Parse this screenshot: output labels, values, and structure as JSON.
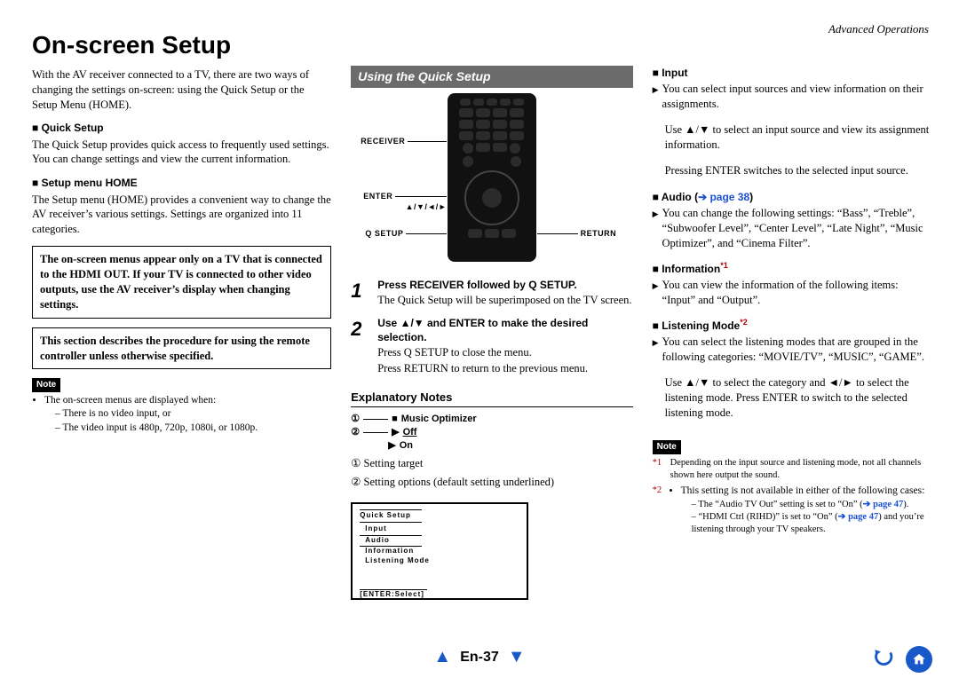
{
  "header": {
    "section": "Advanced Operations"
  },
  "title": "On-screen Setup",
  "left": {
    "intro": "With the AV receiver connected to a TV, there are two ways of changing the settings on-screen: using the Quick Setup or the Setup Menu (HOME).",
    "qs_head": "Quick Setup",
    "qs_body": "The Quick Setup provides quick access to frequently used settings. You can change settings and view the current information.",
    "sm_head": "Setup menu HOME",
    "sm_body": "The Setup menu (HOME) provides a convenient way to change the AV receiver’s various settings. Settings are organized into 11 categories.",
    "box1": "The on-screen menus appear only on a TV that is connected to the HDMI OUT. If your TV is connected to other video outputs, use the AV receiver’s display when changing settings.",
    "box2": "This section describes the procedure for using the remote controller unless otherwise specified.",
    "note_label": "Note",
    "note_lead": "The on-screen menus are displayed when:",
    "note_items": [
      "There is no video input, or",
      "The video input is 480p, 720p, 1080i, or 1080p."
    ]
  },
  "mid": {
    "bar": "Using the Quick Setup",
    "labels": {
      "receiver": "RECEIVER",
      "enter": "ENTER",
      "arrows": "▲/▼/◄/►",
      "qsetup": "Q SETUP",
      "return": "RETURN"
    },
    "step1_head": "Press RECEIVER followed by Q SETUP.",
    "step1_body": "The Quick Setup will be superimposed on the TV screen.",
    "step2_head": "Use ▲/▼ and ENTER to make the desired selection.",
    "step2_b1": "Press Q SETUP to close the menu.",
    "step2_b2": "Press RETURN to return to the previous menu.",
    "expl_head": "Explanatory Notes",
    "expl_item1": "Music Optimizer",
    "expl_opt_off": "Off",
    "expl_opt_on": "On",
    "legend1": "① Setting target",
    "legend2": "② Setting options (default setting underlined)",
    "menu": {
      "title": "Quick Setup",
      "items": [
        "Input",
        "Audio",
        "Information",
        "Listening Mode"
      ],
      "footer": "[ENTER:Select]"
    }
  },
  "right": {
    "input_head": "Input",
    "input_body": "You can select input sources and view information on their assignments.",
    "input_sub1": "Use ▲/▼ to select an input source and view its assignment information.",
    "input_sub2": "Pressing ENTER switches to the selected input source.",
    "audio_head": "Audio (",
    "audio_link": "➔ page 38",
    "audio_tail": ")",
    "audio_body": "You can change the following settings: “Bass”, “Treble”, “Subwoofer Level”, “Center Level”, “Late Night”, “Music Optimizer”, and “Cinema Filter”.",
    "info_head": "Information",
    "info_sup": "*1",
    "info_body": "You can view the information of the following items: “Input” and “Output”.",
    "lm_head": "Listening Mode",
    "lm_sup": "*2",
    "lm_body": "You can select the listening modes that are grouped in the following categories: “MOVIE/TV”, “MUSIC”, “GAME”.",
    "lm_sub": "Use ▲/▼ to select the category and ◄/► to select the listening mode. Press ENTER to switch to the selected listening mode.",
    "note_label": "Note",
    "star1": "Depending on the input source and listening mode, not all channels shown here output the sound.",
    "star2_lead": "This setting is not available in either of the following cases:",
    "star2_a_pre": "The “Audio TV Out” setting is set to “On” (",
    "star2_a_link": "➔ page 47",
    "star2_a_post": ").",
    "star2_b_pre": "“HDMI Ctrl (RIHD)” is set to “On” (",
    "star2_b_link": "➔ page 47",
    "star2_b_post": ") and you’re listening through your TV speakers."
  },
  "footer": {
    "page": "En-37"
  }
}
